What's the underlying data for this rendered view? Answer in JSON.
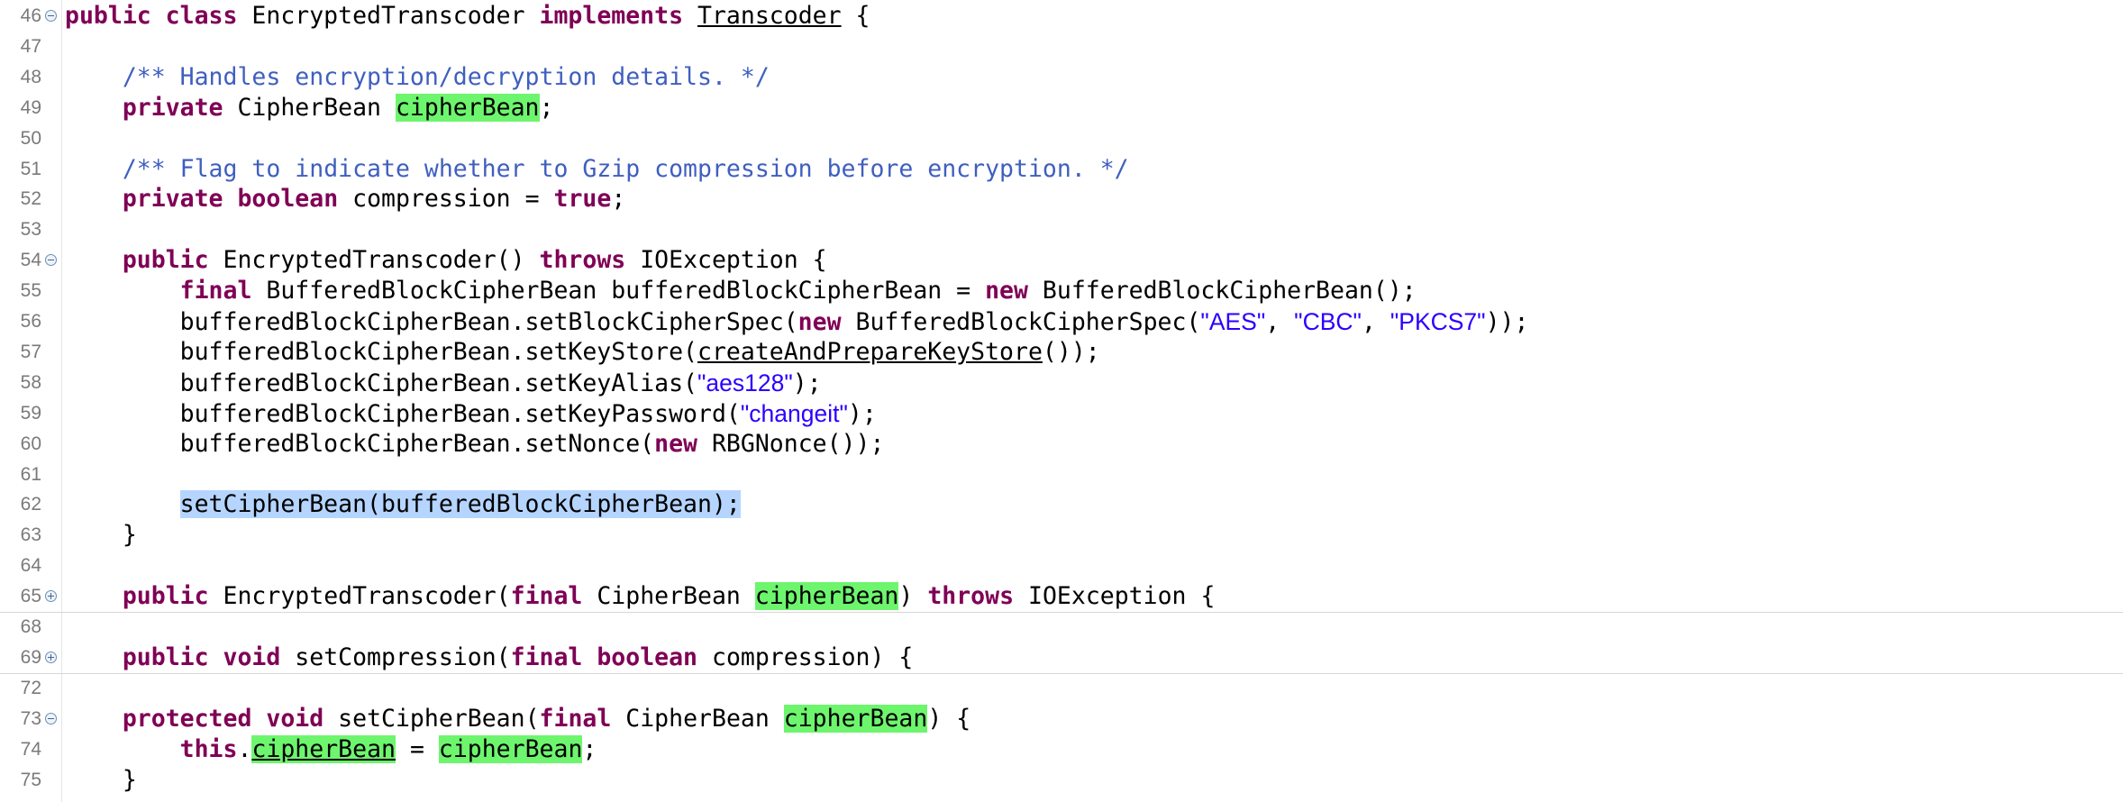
{
  "editor": {
    "language": "java",
    "colors": {
      "keyword": "#7f0055",
      "string": "#2a00ff",
      "javadoc": "#3f5fbf",
      "occurrence_highlight": "#6ef56e",
      "selection": "#b5d5ff",
      "line_number": "#7a7a7a"
    },
    "lines": [
      {
        "num": "46",
        "fold": "collapse",
        "tokens": [
          {
            "t": "kw",
            "v": "public class"
          },
          {
            "t": "plain",
            "v": " EncryptedTranscoder "
          },
          {
            "t": "kw",
            "v": "implements"
          },
          {
            "t": "plain",
            "v": " "
          },
          {
            "t": "ul",
            "v": "Transcoder"
          },
          {
            "t": "plain",
            "v": " {"
          }
        ]
      },
      {
        "num": "47",
        "tokens": []
      },
      {
        "num": "48",
        "tokens": [
          {
            "t": "plain",
            "v": "    "
          },
          {
            "t": "cmt",
            "v": "/** Handles encryption/decryption details. */"
          }
        ]
      },
      {
        "num": "49",
        "tokens": [
          {
            "t": "plain",
            "v": "    "
          },
          {
            "t": "kw",
            "v": "private"
          },
          {
            "t": "plain",
            "v": " CipherBean "
          },
          {
            "t": "occ",
            "v": "cipherBean"
          },
          {
            "t": "plain",
            "v": ";"
          }
        ]
      },
      {
        "num": "50",
        "tokens": []
      },
      {
        "num": "51",
        "tokens": [
          {
            "t": "plain",
            "v": "    "
          },
          {
            "t": "cmt",
            "v": "/** Flag to indicate whether to Gzip compression before encryption. */"
          }
        ]
      },
      {
        "num": "52",
        "tokens": [
          {
            "t": "plain",
            "v": "    "
          },
          {
            "t": "kw",
            "v": "private boolean"
          },
          {
            "t": "plain",
            "v": " compression = "
          },
          {
            "t": "kw",
            "v": "true"
          },
          {
            "t": "plain",
            "v": ";"
          }
        ]
      },
      {
        "num": "53",
        "tokens": []
      },
      {
        "num": "54",
        "fold": "collapse",
        "tokens": [
          {
            "t": "plain",
            "v": "    "
          },
          {
            "t": "kw",
            "v": "public"
          },
          {
            "t": "plain",
            "v": " EncryptedTranscoder() "
          },
          {
            "t": "kw",
            "v": "throws"
          },
          {
            "t": "plain",
            "v": " IOException {"
          }
        ]
      },
      {
        "num": "55",
        "tokens": [
          {
            "t": "plain",
            "v": "        "
          },
          {
            "t": "kw",
            "v": "final"
          },
          {
            "t": "plain",
            "v": " BufferedBlockCipherBean bufferedBlockCipherBean = "
          },
          {
            "t": "kw",
            "v": "new"
          },
          {
            "t": "plain",
            "v": " BufferedBlockCipherBean();"
          }
        ]
      },
      {
        "num": "56",
        "tokens": [
          {
            "t": "plain",
            "v": "        bufferedBlockCipherBean.setBlockCipherSpec("
          },
          {
            "t": "kw",
            "v": "new"
          },
          {
            "t": "plain",
            "v": " BufferedBlockCipherSpec("
          },
          {
            "t": "str",
            "v": "\"AES\""
          },
          {
            "t": "plain",
            "v": ", "
          },
          {
            "t": "str",
            "v": "\"CBC\""
          },
          {
            "t": "plain",
            "v": ", "
          },
          {
            "t": "str",
            "v": "\"PKCS7\""
          },
          {
            "t": "plain",
            "v": "));"
          }
        ]
      },
      {
        "num": "57",
        "tokens": [
          {
            "t": "plain",
            "v": "        bufferedBlockCipherBean.setKeyStore("
          },
          {
            "t": "ul",
            "v": "createAndPrepareKeyStore"
          },
          {
            "t": "plain",
            "v": "());"
          }
        ]
      },
      {
        "num": "58",
        "tokens": [
          {
            "t": "plain",
            "v": "        bufferedBlockCipherBean.setKeyAlias("
          },
          {
            "t": "str",
            "v": "\"aes128\""
          },
          {
            "t": "plain",
            "v": ");"
          }
        ]
      },
      {
        "num": "59",
        "tokens": [
          {
            "t": "plain",
            "v": "        bufferedBlockCipherBean.setKeyPassword("
          },
          {
            "t": "str",
            "v": "\"changeit\""
          },
          {
            "t": "plain",
            "v": ");"
          }
        ]
      },
      {
        "num": "60",
        "tokens": [
          {
            "t": "plain",
            "v": "        bufferedBlockCipherBean.setNonce("
          },
          {
            "t": "kw",
            "v": "new"
          },
          {
            "t": "plain",
            "v": " RBGNonce());"
          }
        ]
      },
      {
        "num": "61",
        "tokens": []
      },
      {
        "num": "62",
        "tokens": [
          {
            "t": "plain",
            "v": "        "
          },
          {
            "t": "sel",
            "v": "setCipherBean(bufferedBlockCipherBean);"
          }
        ]
      },
      {
        "num": "63",
        "tokens": [
          {
            "t": "plain",
            "v": "    }"
          }
        ]
      },
      {
        "num": "64",
        "tokens": []
      },
      {
        "num": "65",
        "fold": "expand",
        "sep": true,
        "tokens": [
          {
            "t": "plain",
            "v": "    "
          },
          {
            "t": "kw",
            "v": "public"
          },
          {
            "t": "plain",
            "v": " EncryptedTranscoder("
          },
          {
            "t": "kw",
            "v": "final"
          },
          {
            "t": "plain",
            "v": " CipherBean "
          },
          {
            "t": "occ",
            "v": "cipherBean"
          },
          {
            "t": "plain",
            "v": ") "
          },
          {
            "t": "kw",
            "v": "throws"
          },
          {
            "t": "plain",
            "v": " IOException {"
          }
        ]
      },
      {
        "num": "68",
        "tokens": []
      },
      {
        "num": "69",
        "fold": "expand",
        "sep": true,
        "tokens": [
          {
            "t": "plain",
            "v": "    "
          },
          {
            "t": "kw",
            "v": "public void"
          },
          {
            "t": "plain",
            "v": " setCompression("
          },
          {
            "t": "kw",
            "v": "final boolean"
          },
          {
            "t": "plain",
            "v": " compression) {"
          }
        ]
      },
      {
        "num": "72",
        "tokens": []
      },
      {
        "num": "73",
        "fold": "collapse",
        "tokens": [
          {
            "t": "plain",
            "v": "    "
          },
          {
            "t": "kw",
            "v": "protected void"
          },
          {
            "t": "plain",
            "v": " setCipherBean("
          },
          {
            "t": "kw",
            "v": "final"
          },
          {
            "t": "plain",
            "v": " CipherBean "
          },
          {
            "t": "occ",
            "v": "cipherBean"
          },
          {
            "t": "plain",
            "v": ") {"
          }
        ]
      },
      {
        "num": "74",
        "tokens": [
          {
            "t": "plain",
            "v": "        "
          },
          {
            "t": "kw",
            "v": "this"
          },
          {
            "t": "plain",
            "v": "."
          },
          {
            "t": "occ-ul",
            "v": "cipherBean"
          },
          {
            "t": "plain",
            "v": " = "
          },
          {
            "t": "occ",
            "v": "cipherBean"
          },
          {
            "t": "plain",
            "v": ";"
          }
        ]
      },
      {
        "num": "75",
        "tokens": [
          {
            "t": "plain",
            "v": "    }"
          }
        ]
      }
    ]
  }
}
